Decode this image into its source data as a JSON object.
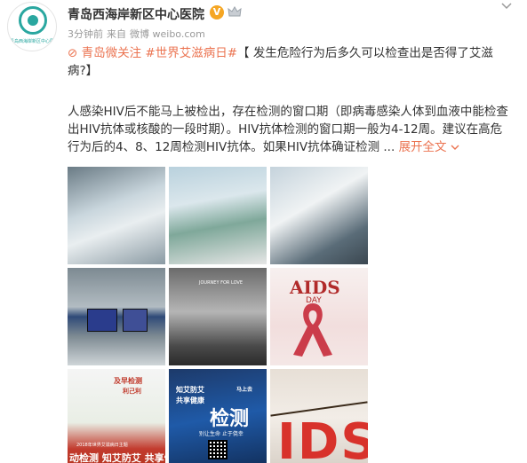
{
  "post": {
    "author": "青岛西海岸新区中心医院",
    "avatar_caption": "青岛西海岸新区中心医院",
    "time": "3分钟前",
    "source_prefix": "来自",
    "source": "微博 weibo.com",
    "line1_tag_icon": "link-icon",
    "line1_link": "青岛微关注",
    "line1_topic": "#世界艾滋病日#",
    "line1_title": "【 发生危险行为后多久可以检查出是否得了艾滋",
    "line2_title": "病?】",
    "paragraph": "人感染HIV后不能马上被检出，存在检测的窗口期（即病毒感染人体到血液中能检查出HIV抗体或核酸的一段时期）。HIV抗体检测的窗口期一般为4-12周。建议在高危行为后的4、8、12周检测HIV抗体。如果HIV抗体确证检测 ...",
    "expand_label": "展开全文",
    "expand_icon": "chevron-down-icon"
  },
  "images": {
    "t4_text": "",
    "t5_caption": "JOURNEY FOR LOVE",
    "t6_title": "AIDS",
    "t6_day": "DAY",
    "t7_badge_a": "及早检测",
    "t7_badge_b": "利己利",
    "t7_small": "2018年世界艾滋病日主题",
    "t7_bottom": "动检测  知艾防艾 共享健",
    "t8_a": "知艾防艾",
    "t8_b": "共享健康",
    "t8_c": "马上去",
    "t8_big": "检测",
    "t8_d": "别让生命  止于侥幸",
    "t9_letters": "IDS"
  },
  "colors": {
    "link": "#eb7350",
    "verified": "#f5a623",
    "meta": "#999999"
  }
}
